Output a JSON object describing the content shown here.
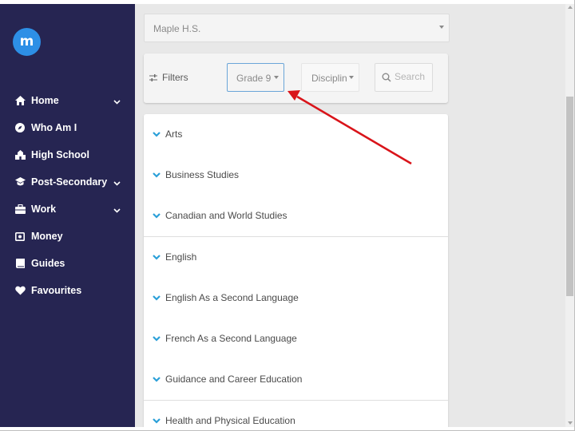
{
  "sidebar": {
    "logo_letter": "m",
    "items": [
      {
        "label": "Home",
        "icon": "home-icon",
        "has_chevron": true
      },
      {
        "label": "Who Am I",
        "icon": "compass-icon",
        "has_chevron": false
      },
      {
        "label": "High School",
        "icon": "school-icon",
        "has_chevron": false
      },
      {
        "label": "Post-Secondary",
        "icon": "graduation-cap-icon",
        "has_chevron": true
      },
      {
        "label": "Work",
        "icon": "briefcase-icon",
        "has_chevron": true
      },
      {
        "label": "Money",
        "icon": "money-icon",
        "has_chevron": false
      },
      {
        "label": "Guides",
        "icon": "book-icon",
        "has_chevron": false
      },
      {
        "label": "Favourites",
        "icon": "heart-icon",
        "has_chevron": false
      }
    ]
  },
  "school_select": {
    "value": "Maple H.S."
  },
  "filters": {
    "label": "Filters",
    "grade": "Grade 9",
    "discipline": "Discipline",
    "search_placeholder": "Search"
  },
  "subjects": [
    "Arts",
    "Business Studies",
    "Canadian and World Studies",
    "English",
    "English As a Second Language",
    "French As a Second Language",
    "Guidance and Career Education",
    "Health and Physical Education"
  ],
  "colors": {
    "sidebar_bg": "#262552",
    "logo_blue": "#2d8fe6",
    "accent_blue": "#2a9fd8",
    "annotation_arrow": "#d9141a"
  }
}
